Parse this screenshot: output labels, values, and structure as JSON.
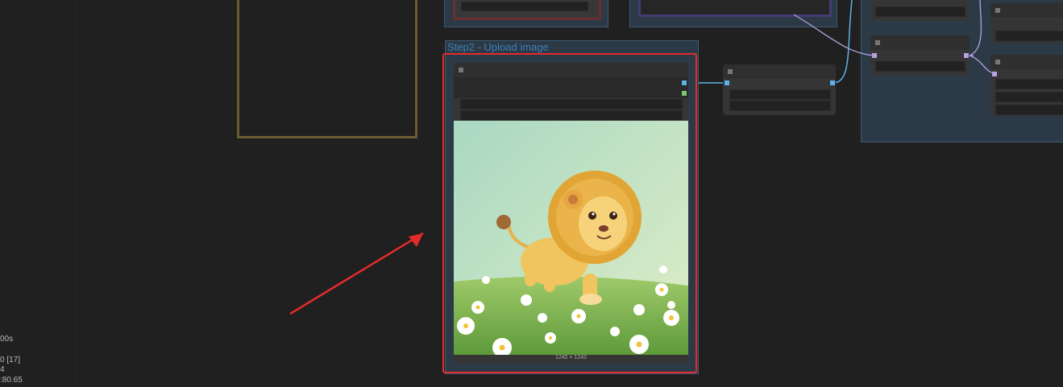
{
  "canvas": {
    "group_title": "Step2 - Upload image",
    "image_resolution": "1242 × 1242",
    "highlight_color": "#e32b2b",
    "link_colors": {
      "image": "#5bb3e8",
      "clip": "#b7a0e0"
    }
  },
  "stats": {
    "line1": "00s",
    "line2": "0 [17]",
    "line3": "4",
    "line4": ":80.65"
  },
  "image": {
    "description_icon": "lion-cartoon-image"
  }
}
